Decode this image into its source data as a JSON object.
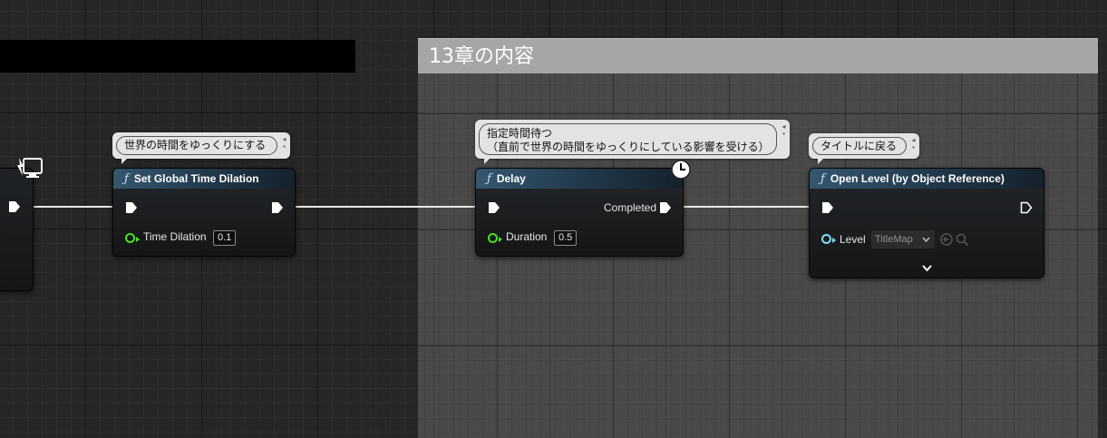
{
  "comment_group": {
    "title": "13章の内容"
  },
  "nodes": {
    "set_global_time_dilation": {
      "title": "Set Global Time Dilation",
      "comment": "世界の時間をゆっくりにする",
      "pin_label": "Time Dilation",
      "pin_value": "0.1"
    },
    "delay": {
      "title": "Delay",
      "comment_line1": "指定時間待つ",
      "comment_line2": "（直前で世界の時間をゆっくりにしている影響を受ける）",
      "output_label": "Completed",
      "pin_label": "Duration",
      "pin_value": "0.5"
    },
    "open_level": {
      "title": "Open Level (by Object Reference)",
      "comment": "タイトルに戻る",
      "pin_label": "Level",
      "level_value": "TitleMap"
    }
  },
  "icons": {
    "function": "ƒ",
    "comment_pin": "pin-icon",
    "latent": "clock-icon",
    "left_node": "network-replication-icon",
    "browse": "arrow-left-circle-icon",
    "search": "search-icon",
    "expand": "chevron-down-icon"
  },
  "colors": {
    "exec_wire": "#e8e8e8",
    "float_pin": "#4be01d",
    "object_pin": "#7fe0ff",
    "node_header": "#35576f"
  }
}
